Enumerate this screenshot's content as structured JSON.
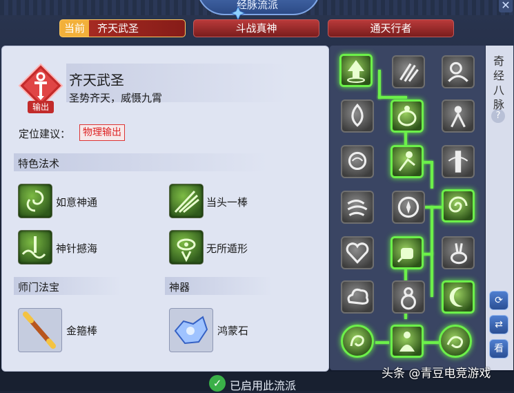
{
  "window": {
    "title": "经脉流派",
    "close_icon": "close-icon"
  },
  "tabs": [
    {
      "prefix": "当前",
      "label": "齐天武圣",
      "active": true
    },
    {
      "label": "斗战真神",
      "active": false
    },
    {
      "label": "通天行者",
      "active": false
    }
  ],
  "school": {
    "role_tag": "输出",
    "name": "齐天武圣",
    "motto": "圣势齐天，威慑九霄",
    "position_label": "定位建议：",
    "position_value": "物理输出"
  },
  "sections": {
    "special": "特色法术",
    "treasure": "师门法宝",
    "artifact": "神器"
  },
  "skills": [
    {
      "name": "如意神通",
      "icon": "swirl-icon"
    },
    {
      "name": "当头一棒",
      "icon": "strike-icon"
    },
    {
      "name": "神针撼海",
      "icon": "wave-icon"
    },
    {
      "name": "无所遁形",
      "icon": "eye-icon"
    }
  ],
  "treasure": {
    "name": "金箍棒",
    "icon": "staff-icon"
  },
  "artifact": {
    "name": "鸿蒙石",
    "icon": "stone-icon"
  },
  "meridian": {
    "side_title": "奇经八脉",
    "help": "?",
    "buttons": {
      "reset": "⟳",
      "swap": "⇄",
      "view": "看"
    }
  },
  "footer": {
    "status": "已启用此流派"
  },
  "watermark": "头条 @青豆电竞游戏"
}
